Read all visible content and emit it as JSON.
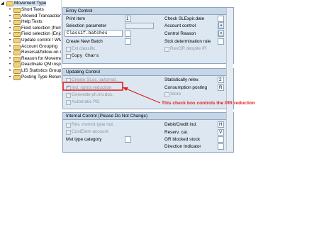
{
  "tree": {
    "root": "Movement Type",
    "items": [
      "Short Texts",
      "Allowed Transaction",
      "Help Texts",
      "Field selection (from",
      "Field selection (Enjo",
      "Update control / WM",
      "Account Grouping",
      "Reversal/follow-on m",
      "Reason for Movement",
      "Deactivate QM inspe",
      "LIS Statistics Group",
      "Posting Type Return"
    ]
  },
  "entry_control": {
    "title": "Entry Control",
    "print_item": "Print item",
    "print_item_value": "1",
    "selection_parameter": "Selection parameter",
    "classif_batches": "Classif.batches",
    "create_new_batch": "Create New Batch",
    "ext_classific": "Ext.classific.",
    "copy_chars": "Copy Chars",
    "check_slexpir": "Check SLExpir.date",
    "account_control": "Account control",
    "control_reason": "Control Reason",
    "stck_det_rule": "Stck determination rule",
    "revgr": "RevGR despite IR"
  },
  "updating_control": {
    "title": "Updating Control",
    "create_sloc": "Create SLoc. automat.",
    "ind_rqmts": "Ind. rqmts reduction",
    "generate_ph": "Generate ph.inv.doc.",
    "automatic_po": "Automatic PO",
    "statistically_relev": "Statistically relev.",
    "statistically_relev_value": "2",
    "consumption_posting": "Consumption posting",
    "consumption_posting_value": "R",
    "store": "Store"
  },
  "internal_control": {
    "title": "Internal Control (Please Do Not Change)",
    "rev_mvmnt": "Rev. mvmnt type ind.",
    "costelem": "CostElem account",
    "mvt_type_category": "Mvt type category",
    "debit_credit": "Debit/Credit ind.",
    "debit_credit_value": "H",
    "reserv_cat": "Reserv. cat.",
    "reserv_cat_value": "V",
    "gr_blocked": "GR blocked stock",
    "direction_indicator": "Direction Indicator"
  },
  "annotation": {
    "text": "This check box controls the PIR reduction",
    "color": "#e02020"
  }
}
